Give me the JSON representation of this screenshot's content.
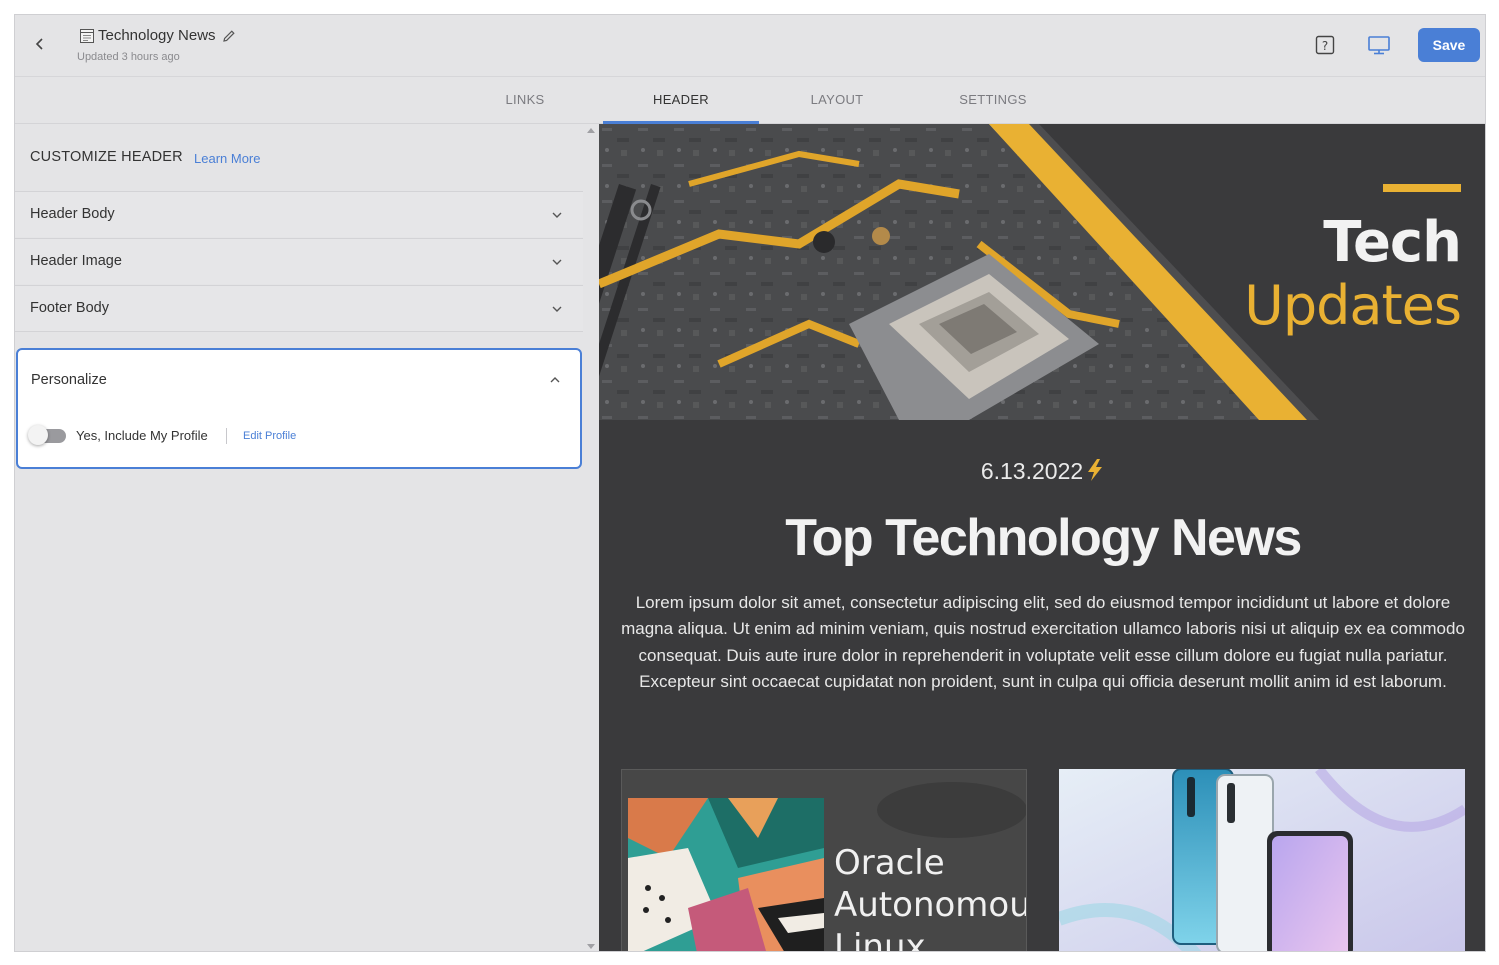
{
  "header": {
    "doc_title": "Technology News",
    "updated": "Updated 3 hours ago",
    "save_label": "Save"
  },
  "tabs": [
    {
      "label": "LINKS"
    },
    {
      "label": "HEADER"
    },
    {
      "label": "LAYOUT"
    },
    {
      "label": "SETTINGS"
    }
  ],
  "sidebar": {
    "title": "CUSTOMIZE HEADER",
    "learn_more": "Learn More",
    "sections": [
      {
        "label": "Header Body"
      },
      {
        "label": "Header Image"
      },
      {
        "label": "Footer Body"
      }
    ],
    "personalize": {
      "title": "Personalize",
      "toggle_label": "Yes, Include My Profile",
      "edit_profile": "Edit Profile"
    }
  },
  "preview": {
    "hero_title_line1": "Tech",
    "hero_title_line2": "Updates",
    "date": "6.13.2022",
    "headline": "Top Technology News",
    "body": "Lorem ipsum dolor sit amet, consectetur adipiscing elit, sed do eiusmod tempor incididunt ut labore et dolore magna aliqua. Ut enim ad minim veniam, quis nostrud exercitation ullamco laboris nisi ut aliquip ex ea commodo consequat. Duis aute irure dolor in reprehenderit in voluptate velit esse cillum dolore eu fugiat nulla pariatur. Excepteur sint occaecat cupidatat non proident, sunt in culpa qui officia deserunt mollit anim id est laborum.",
    "card1_text": "Oracle\nAutonomous\nLinux"
  },
  "colors": {
    "accent": "#4a7fd6",
    "gold": "#e9b133",
    "preview_bg": "#3a3a3c"
  }
}
